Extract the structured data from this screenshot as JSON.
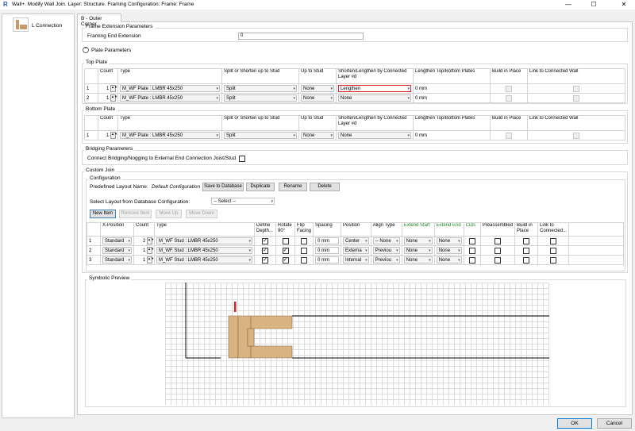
{
  "window": {
    "title": "Wall+. Modify Wall Join. Layer: Structure. Framing Configuration: Frame: Frame",
    "app_icon": "R",
    "minimize_glyph": "—",
    "maximize_glyph": "☐",
    "close_glyph": "✕"
  },
  "left_panel": {
    "items": [
      {
        "label": "L Connection",
        "icon": "l-connection-icon"
      }
    ]
  },
  "tab": {
    "label": "B - Outer Corner"
  },
  "frame_extension": {
    "group_label": "Frame Extension Parameters",
    "field_label": "Framing End Extension",
    "value": "0"
  },
  "plate_parameters": {
    "label": "Plate Parameters",
    "collapse_glyph": "⌃"
  },
  "plate_columns": [
    "Count",
    "Type",
    "Split or Shorten up to Stud",
    "Up to Stud",
    "Shorten/Lengthen by Connected Layer #d",
    "Lengthen Top/Bottom Plates",
    "Build in Place",
    "Link to Connected Wall"
  ],
  "top_plate": {
    "label": "Top Plate",
    "rows": [
      {
        "num": "1",
        "count": "1",
        "type": "M_WF Plate : LMBR 45x250",
        "split": "Split",
        "up_to_stud": "None",
        "shorten": "Lengthen",
        "lengthen": "0 mm"
      },
      {
        "num": "2",
        "count": "1",
        "type": "M_WF Plate : LMBR 45x250",
        "split": "Split",
        "up_to_stud": "None",
        "shorten": "None",
        "lengthen": "0 mm"
      }
    ]
  },
  "bottom_plate": {
    "label": "Bottom Plate",
    "rows": [
      {
        "num": "1",
        "count": "1",
        "type": "M_WF Plate : LMBR 45x250",
        "split": "Split",
        "up_to_stud": "None",
        "shorten": "None",
        "lengthen": "0 mm"
      }
    ]
  },
  "bridging": {
    "group_label": "Bridging Parameters",
    "checkbox_label": "Connect Bridging/Nogging to External End Connection Joist/Stud"
  },
  "custom_join": {
    "group_label": "Custom Join",
    "config_label": "Configuration",
    "predefined_label": "Predefined Layout Name:",
    "predefined_value": "Default Configuration",
    "buttons": {
      "save": "Save to Database",
      "duplicate": "Duplicate",
      "rename": "Rename",
      "delete": "Delete"
    },
    "select_label": "Select Layout from Database Configuration:",
    "select_value": "-- Select --",
    "item_buttons": {
      "new": "New Item",
      "remove": "Remove Item",
      "up": "Move Up",
      "down": "Move Down"
    },
    "columns": [
      "X-Position",
      "Count",
      "Type",
      "Define Depth...",
      "Rotate 90°",
      "Flip Facing",
      "Spacing",
      "Position",
      "Align Type",
      "Extend Start",
      "Extend End",
      "Cuts",
      "Preassembled",
      "Build in Place",
      "Link to Connected..."
    ],
    "green_columns": [
      "Extend Start",
      "Extend End",
      "Cuts"
    ],
    "rows": [
      {
        "num": "1",
        "xpos": "Standard",
        "count": "2",
        "type": "M_WF Stud : LMBR 45x250",
        "define_depth": true,
        "rotate": false,
        "flip": false,
        "spacing": "0 mm",
        "position": "Center",
        "align": "-- None",
        "ext_start": "None",
        "ext_end": "None"
      },
      {
        "num": "2",
        "xpos": "Standard",
        "count": "1",
        "type": "M_WF Stud : LMBR 45x250",
        "define_depth": true,
        "rotate": true,
        "flip": false,
        "spacing": "0 mm",
        "position": "Externa",
        "align": "Previou",
        "ext_start": "None",
        "ext_end": "None"
      },
      {
        "num": "3",
        "xpos": "Standard",
        "count": "1",
        "type": "M_WF Stud : LMBR 45x250",
        "define_depth": true,
        "rotate": true,
        "flip": false,
        "spacing": "0 mm",
        "position": "Internal",
        "align": "Previou",
        "ext_start": "None",
        "ext_end": "None"
      }
    ]
  },
  "preview": {
    "label": "Symbolic Preview",
    "stud_color": "#d9b382",
    "marker_color": "#e02020"
  },
  "footer": {
    "ok": "OK",
    "cancel": "Cancel"
  }
}
